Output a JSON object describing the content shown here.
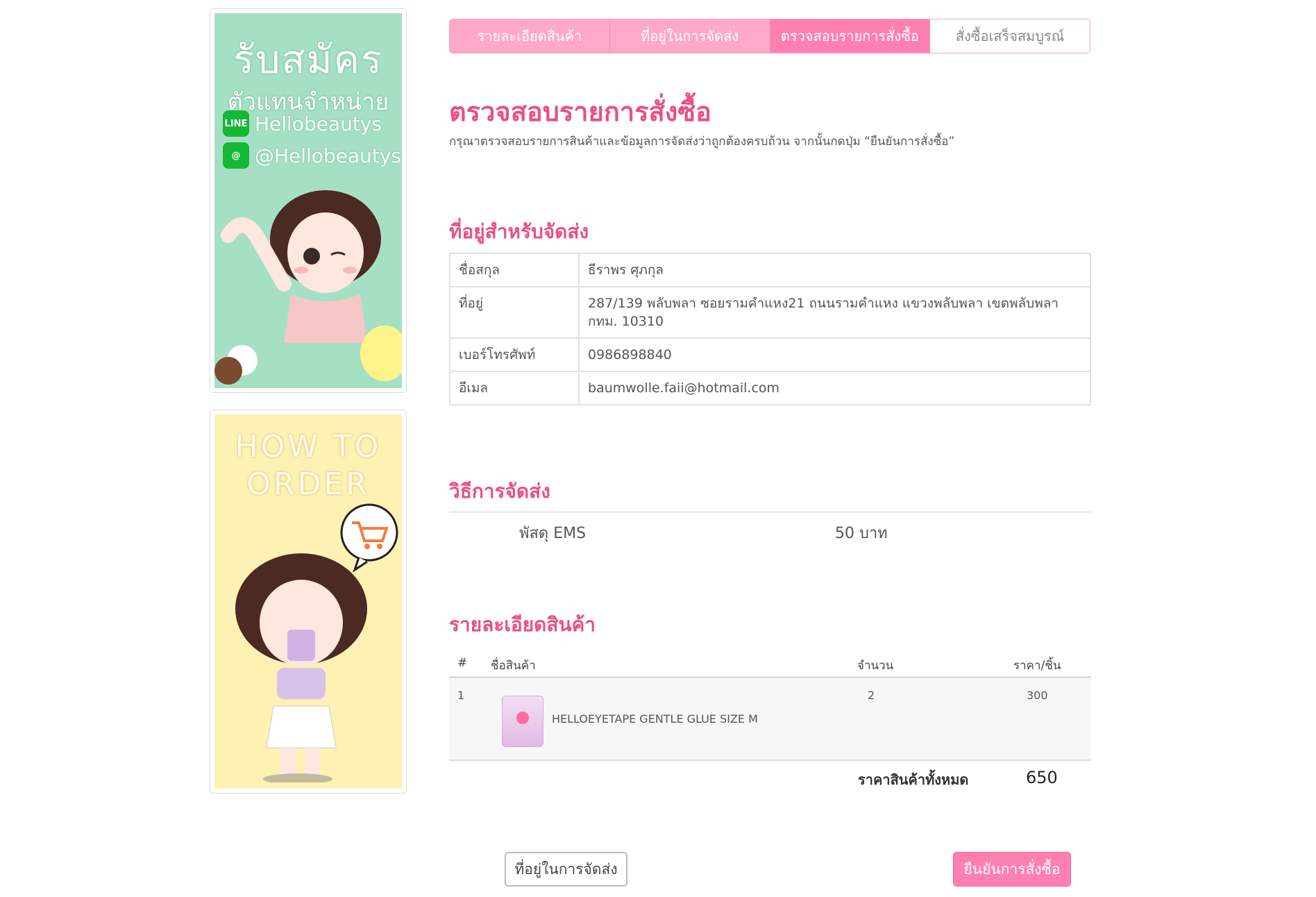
{
  "banners": {
    "recruit": {
      "title": "รับสมัคร",
      "subtitle": "ตัวแทนจำหน่าย",
      "line_id": "Hellobeautys",
      "at_id": "@Hellobeautys",
      "line_icon_text": "LINE",
      "at_icon_text": "@"
    },
    "how_to_order": {
      "line1": "HOW TO",
      "line2": "ORDER"
    }
  },
  "steps": [
    {
      "label": "รายละเอียดสินค้า",
      "state": "done"
    },
    {
      "label": "ที่อยู่ในการจัดส่ง",
      "state": "done"
    },
    {
      "label": "ตรวจสอบรายการสั่งซื้อ",
      "state": "active"
    },
    {
      "label": "สั่งซื้อเสร็จสมบูรณ์",
      "state": "todo"
    }
  ],
  "page": {
    "title": "ตรวจสอบรายการสั่งซื้อ",
    "instruction": "กรุณาตรวจสอบรายการสินค้าและข้อมูลการจัดส่งว่าถูกต้องครบถ้วน จากนั้นกดปุ่ม “ยืนยันการสั่งซื้อ”"
  },
  "shipping_address": {
    "heading": "ที่อยู่สำหรับจัดส่ง",
    "rows": [
      {
        "label": "ชื่อสกุล",
        "value": "ธีราพร ศุภกุล"
      },
      {
        "label": "ที่อยู่",
        "value": "287/139 พลับพลา ซอยรามคำแหง21 ถนนรามคำแหง แขวงพลับพลา เขตพลับพลา กทม. 10310"
      },
      {
        "label": "เบอร์โทรศัพท์",
        "value": "0986898840"
      },
      {
        "label": "อีเมล",
        "value": "baumwolle.faii@hotmail.com"
      }
    ]
  },
  "shipping_method": {
    "heading": "วิธีการจัดส่ง",
    "name": "พัสดุ EMS",
    "price": "50 บาท"
  },
  "products": {
    "heading": "รายละเอียดสินค้า",
    "columns": {
      "num": "#",
      "name": "ชื่อสินค้า",
      "qty": "จำนวน",
      "price": "ราคา/ชิ้น"
    },
    "items": [
      {
        "num": "1",
        "name": "HELLOEYETAPE GENTLE GLUE SIZE M",
        "qty": "2",
        "price": "300"
      }
    ],
    "total_label": "ราคาสินค้าทั้งหมด",
    "total_value": "650"
  },
  "buttons": {
    "back": "ที่อยู่ในการจัดส่ง",
    "confirm": "ยืนยันการสั่งซื้อ"
  },
  "colors": {
    "accent": "#e94f86",
    "tab_done": "#ffa8c8",
    "tab_active": "#ff7fb0",
    "banner_green": "#a6e0c4",
    "banner_yellow": "#fdf1b3"
  }
}
